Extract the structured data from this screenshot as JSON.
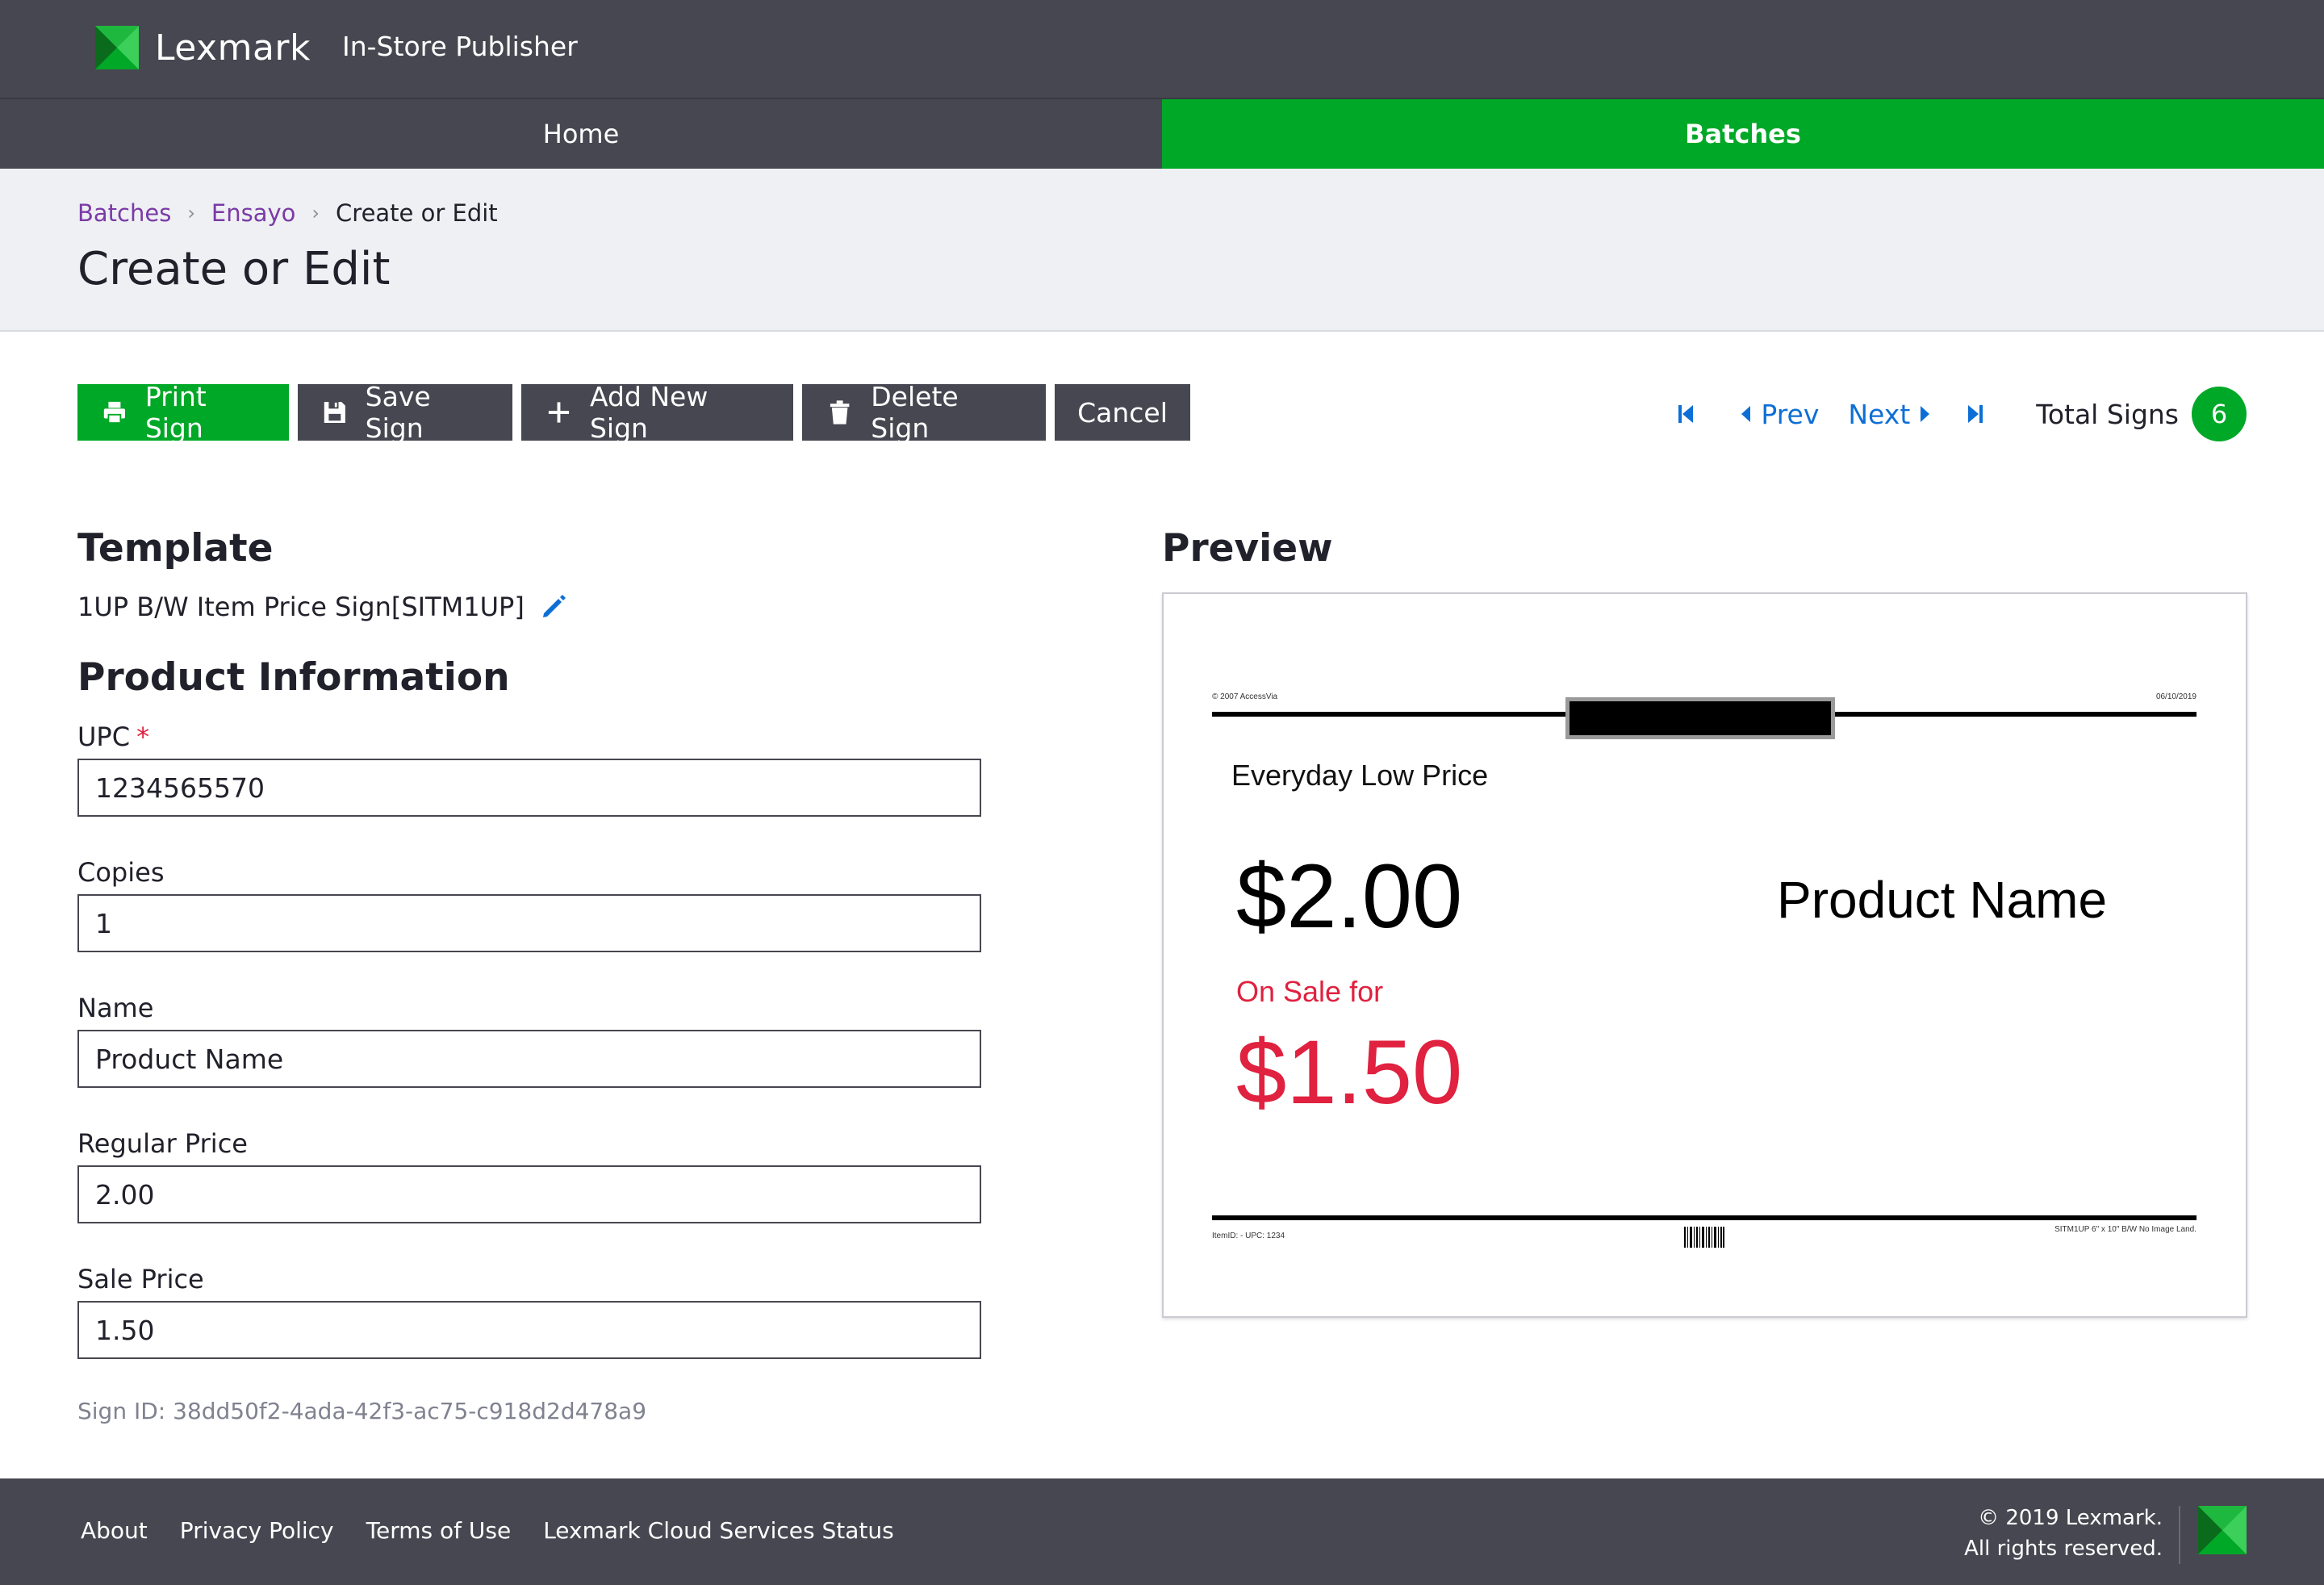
{
  "header": {
    "brand": "Lexmark",
    "app_name": "In-Store Publisher"
  },
  "nav": {
    "home": "Home",
    "batches": "Batches",
    "active": "Batches"
  },
  "breadcrumb": {
    "items": [
      "Batches",
      "Ensayo"
    ],
    "current": "Create or Edit"
  },
  "page_title": "Create or Edit",
  "toolbar": {
    "print": "Print Sign",
    "save": "Save Sign",
    "add": "Add New Sign",
    "delete": "Delete Sign",
    "cancel": "Cancel"
  },
  "pager": {
    "prev": "Prev",
    "next": "Next",
    "total_label": "Total Signs",
    "total": "6"
  },
  "template": {
    "heading": "Template",
    "name": "1UP B/W Item Price Sign[SITM1UP]"
  },
  "product": {
    "heading": "Product Information",
    "fields": {
      "upc": {
        "label": "UPC",
        "value": "1234565570",
        "required_mark": "*"
      },
      "copies": {
        "label": "Copies",
        "value": "1"
      },
      "name": {
        "label": "Name",
        "value": "Product Name"
      },
      "regular_price": {
        "label": "Regular Price",
        "value": "2.00"
      },
      "sale_price": {
        "label": "Sale Price",
        "value": "1.50"
      }
    },
    "sign_id": "Sign ID: 38dd50f2-4ada-42f3-ac75-c918d2d478a9"
  },
  "preview": {
    "heading": "Preview",
    "copyright_small": "© 2007 AccessVia",
    "date_small": "06/10/2019",
    "everyday": "Everyday Low Price",
    "regular_price": "$2.00",
    "on_sale": "On Sale for",
    "sale_price": "$1.50",
    "product_name": "Product Name",
    "item_small": "ItemID:  - UPC: 1234",
    "template_small": "SITM1UP 6\" x 10\" B/W No Image Land."
  },
  "footer": {
    "links": [
      "About",
      "Privacy Policy",
      "Terms of Use",
      "Lexmark Cloud Services Status"
    ],
    "copyright_line1": "© 2019 Lexmark.",
    "copyright_line2": "All rights reserved."
  },
  "colors": {
    "header_bg": "#474751",
    "accent_green": "#00a827",
    "link_blue": "#0d6fd6",
    "breadcrumb_purple": "#7b3aa6",
    "sale_red": "#e0213f"
  }
}
